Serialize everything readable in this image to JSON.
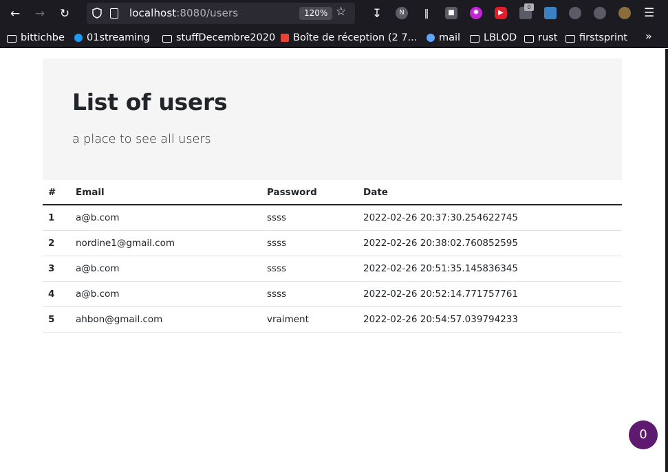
{
  "browser": {
    "url_host": "localhost",
    "url_rest": ":8080/users",
    "zoom": "120%",
    "notification_count": "0",
    "bookmarks": [
      {
        "label": "bittichbe",
        "icon": "folder-icon"
      },
      {
        "label": "01streaming",
        "icon": "site-icon"
      },
      {
        "label": "stuffDecembre2020",
        "icon": "folder-icon"
      },
      {
        "label": "Boîte de réception (2 7...",
        "icon": "gmail-icon"
      },
      {
        "label": "mail",
        "icon": "site-icon"
      },
      {
        "label": "LBLOD",
        "icon": "folder-icon"
      },
      {
        "label": "rust",
        "icon": "folder-icon"
      },
      {
        "label": "firstsprint",
        "icon": "folder-icon"
      }
    ]
  },
  "page": {
    "title": "List of users",
    "subtitle": "a place to see all users"
  },
  "table": {
    "headers": [
      "#",
      "Email",
      "Password",
      "Date"
    ],
    "rows": [
      {
        "id": "1",
        "email": "a@b.com",
        "password": "ssss",
        "date": "2022-02-26 20:37:30.254622745"
      },
      {
        "id": "2",
        "email": "nordine1@gmail.com",
        "password": "ssss",
        "date": "2022-02-26 20:38:02.760852595"
      },
      {
        "id": "3",
        "email": "a@b.com",
        "password": "ssss",
        "date": "2022-02-26 20:51:35.145836345"
      },
      {
        "id": "4",
        "email": "a@b.com",
        "password": "ssss",
        "date": "2022-02-26 20:52:14.771757761"
      },
      {
        "id": "5",
        "email": "ahbon@gmail.com",
        "password": "vraiment",
        "date": "2022-02-26 20:54:57.039794233"
      }
    ]
  },
  "counter_button": "0",
  "colors": {
    "chrome_bg": "#1c1b22",
    "urlbar_bg": "#2b2a33",
    "jumbotron_bg": "#f5f5f5",
    "fab_bg": "#5d1a6e"
  }
}
